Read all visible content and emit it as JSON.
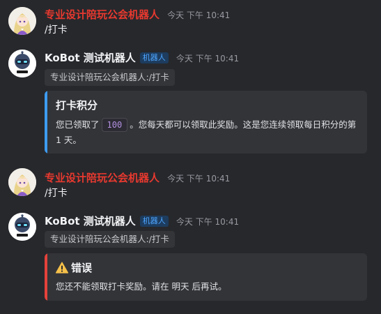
{
  "messages": [
    {
      "type": "user",
      "author": "专业设计陪玩公会机器人",
      "time": "今天 下午 10:41",
      "text": "/打卡"
    },
    {
      "type": "bot",
      "author": "KoBot 测试机器人",
      "tag": "机器人",
      "time": "今天 下午 10:41",
      "reply_ref": "专业设计陪玩公会机器人:/打卡",
      "embed": {
        "title": "打卡积分",
        "text_before": "您已领取了",
        "value": "100",
        "text_after": "。您每天都可以领取此奖励。这是您连续领取每日积分的第 1 天。"
      }
    },
    {
      "type": "user",
      "author": "专业设计陪玩公会机器人",
      "time": "今天 下午 10:41",
      "text": "/打卡"
    },
    {
      "type": "bot",
      "author": "KoBot 测试机器人",
      "tag": "机器人",
      "time": "今天 下午 10:41",
      "reply_ref": "专业设计陪玩公会机器人:/打卡",
      "embed": {
        "title": "错误",
        "text": "您还不能领取打卡奖励。请在 明天 后再试。"
      }
    }
  ],
  "colors": {
    "user_name": "#e8392f",
    "points_accent": "#3d9bf0",
    "error_accent": "#e4423b",
    "warning_icon": "#f5c04a"
  },
  "icons": {
    "user_avatar": "anime-girl-avatar",
    "bot_avatar": "robot-avatar",
    "error_icon": "warning-icon"
  }
}
